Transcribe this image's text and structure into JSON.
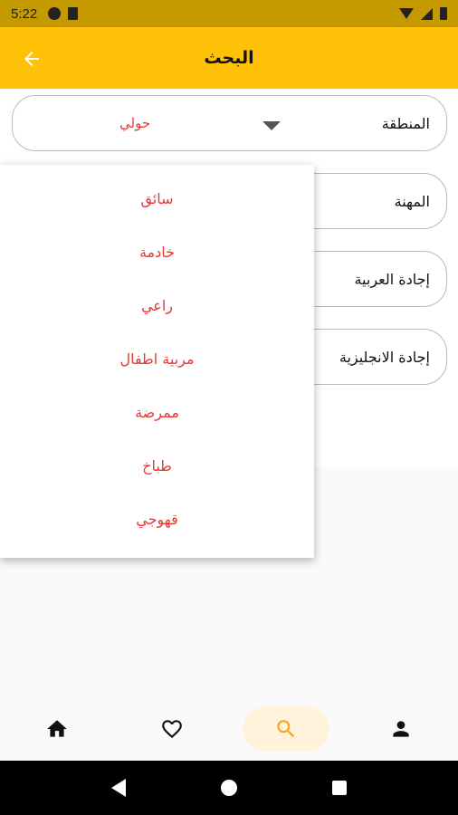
{
  "status_bar": {
    "time": "5:22"
  },
  "app_bar": {
    "title": "البحث"
  },
  "form": {
    "region": {
      "label": "المنطقة",
      "value": "حولي"
    },
    "profession": {
      "label": "المهنة"
    },
    "arabic": {
      "label": "إجادة العربية"
    },
    "english": {
      "label": "إجادة الانجليزية"
    }
  },
  "menu": {
    "items": [
      "سائق",
      "خادمة",
      "راعي",
      "مربية اطفال",
      "ممرضة",
      "طباخ",
      "قهوجي"
    ]
  },
  "bottom_nav": {
    "items": [
      "home-icon",
      "favorite-icon",
      "search-icon",
      "person-icon"
    ],
    "active": "search",
    "accent": "#ffc107"
  }
}
